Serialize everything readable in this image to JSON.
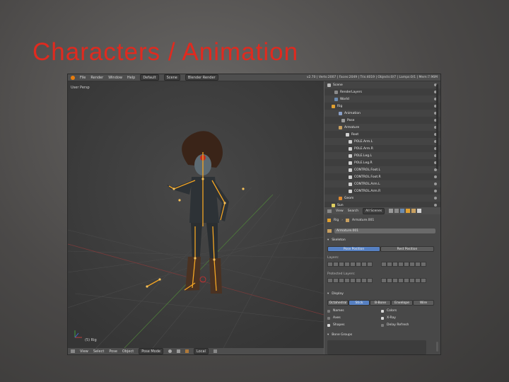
{
  "slide": {
    "title": "Characters / Animation"
  },
  "topbar": {
    "menus": [
      "File",
      "Render",
      "Window",
      "Help"
    ],
    "layout": "Default",
    "scene": "Scene",
    "engine": "Blender Render",
    "stats": "v2.70 | Verts:2007 | Faces:2049 | Tris:4019 | Objects:0/7 | Lamps:0/1 | Mem:7.96M"
  },
  "viewport": {
    "label": "User Persp",
    "object_label": "(5) Rig"
  },
  "viewport_header": {
    "menus": [
      "View",
      "Select",
      "Pose",
      "Object"
    ],
    "mode": "Pose Mode",
    "orientation": "Local"
  },
  "outliner": {
    "rows": [
      "Scene",
      "RenderLayers",
      "World",
      "Rig",
      "Animation",
      "Pose",
      "Armature",
      "Root",
      "POLE.Arm.L",
      "POLE.Arm.R",
      "POLE.Leg.L",
      "POLE.Leg.R",
      "CONTROL.Foot.L",
      "CONTROL.Foot.R",
      "CONTROL.Arm.L",
      "CONTROL.Arm.R",
      "Geom",
      "Sun"
    ]
  },
  "properties_header": {
    "menus": [
      "View",
      "Search"
    ],
    "filter": "All Scenes"
  },
  "properties": {
    "breadcrumb_obj": "Rig",
    "breadcrumb_data": "Armature.001",
    "datablock": "Armature.001",
    "skeleton": {
      "header": "Skeleton",
      "pose_btn": "Pose Position",
      "rest_btn": "Rest Position",
      "layers_label": "Layers:",
      "protected_label": "Protected Layers:"
    },
    "display": {
      "header": "Display",
      "tabs": [
        "Octahedral",
        "Stick",
        "B-Bone",
        "Envelope",
        "Wire"
      ],
      "options_left": [
        "Names",
        "Axes",
        "Shapes"
      ],
      "options_right": [
        "Colors",
        "X-Ray",
        "Delay Refresh"
      ]
    },
    "bone_groups": {
      "header": "Bone Groups"
    }
  },
  "colors": {
    "title": "#e02a1f",
    "bone": "#f5a623",
    "accent": "#5680c2"
  }
}
